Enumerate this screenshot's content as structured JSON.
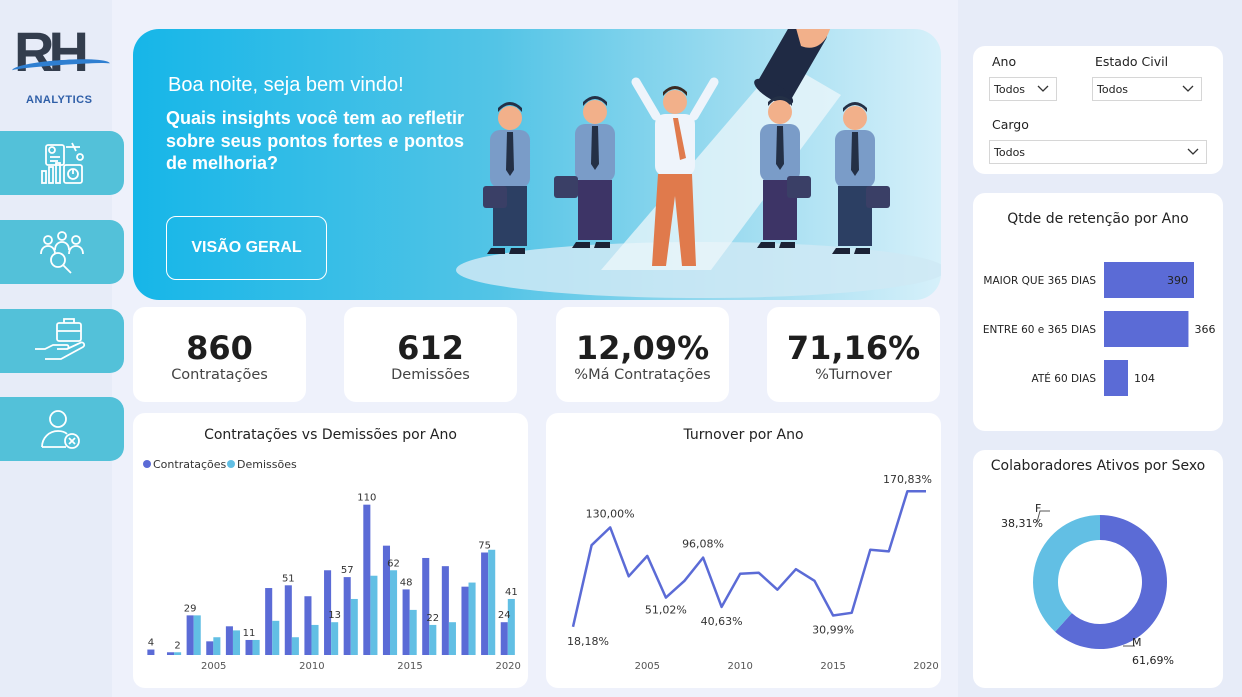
{
  "brand": {
    "logo_text": "RH",
    "logo_sub": "ANALYTICS"
  },
  "nav": [
    {
      "name": "dashboard-icon"
    },
    {
      "name": "people-search-icon"
    },
    {
      "name": "hand-briefcase-icon"
    },
    {
      "name": "user-remove-icon"
    }
  ],
  "hero": {
    "greeting": "Boa noite, seja bem vindo!",
    "question": "Quais insights você tem ao refletir sobre seus pontos fortes e pontos de melhoria?",
    "button": "VISÃO GERAL"
  },
  "kpis": [
    {
      "value": "860",
      "label": "Contratações"
    },
    {
      "value": "612",
      "label": "Demissões"
    },
    {
      "value": "12,09%",
      "label": "%Má Contratações"
    },
    {
      "value": "71,16%",
      "label": "%Turnover"
    }
  ],
  "filters": {
    "ano": {
      "label": "Ano",
      "value": "Todos"
    },
    "estado_civil": {
      "label": "Estado Civil",
      "value": "Todos"
    },
    "cargo": {
      "label": "Cargo",
      "value": "Todos"
    }
  },
  "colors": {
    "primary": "#5b6bd6",
    "secondary": "#62bfe4",
    "accent": "#53c1d9"
  },
  "chart_data": [
    {
      "type": "bar",
      "title": "Contratações vs Demissões por Ano",
      "legend": "top-left",
      "x": [
        2002,
        2003,
        2004,
        2005,
        2006,
        2007,
        2008,
        2009,
        2010,
        2011,
        2012,
        2013,
        2014,
        2015,
        2016,
        2017,
        2018,
        2019,
        2020
      ],
      "x_ticks": [
        "2005",
        "2010",
        "2015",
        "2020"
      ],
      "series": [
        {
          "name": "Contratações",
          "color": "#5b6bd6",
          "values": [
            4,
            2,
            29,
            10,
            21,
            11,
            49,
            51,
            43,
            62,
            57,
            110,
            80,
            48,
            71,
            65,
            50,
            75,
            24
          ]
        },
        {
          "name": "Demissões",
          "color": "#62bfe4",
          "values": [
            0,
            2,
            29,
            13,
            18,
            11,
            25,
            13,
            22,
            24,
            41,
            58,
            62,
            33,
            22,
            24,
            53,
            77,
            41
          ]
        }
      ],
      "data_labels": [
        {
          "x": 2002,
          "series": "Contratações",
          "text": "4"
        },
        {
          "x": 2003,
          "series": "Demissões",
          "text": "2"
        },
        {
          "x": 2004,
          "series": "Contratações",
          "text": "29"
        },
        {
          "x": 2007,
          "series": "Contratações",
          "text": "11"
        },
        {
          "x": 2009,
          "series": "Contratações",
          "text": "51"
        },
        {
          "x": 2011,
          "series": "Demissões",
          "text": "13"
        },
        {
          "x": 2012,
          "series": "Contratações",
          "text": "57"
        },
        {
          "x": 2013,
          "series": "Contratações",
          "text": "110"
        },
        {
          "x": 2014,
          "series": "Demissões",
          "text": "62"
        },
        {
          "x": 2015,
          "series": "Contratações",
          "text": "48"
        },
        {
          "x": 2016,
          "series": "Demissões",
          "text": "22"
        },
        {
          "x": 2019,
          "series": "Contratações",
          "text": "75"
        },
        {
          "x": 2020,
          "series": "Contratações",
          "text": "24"
        },
        {
          "x": 2020,
          "series": "Demissões",
          "text": "41"
        }
      ],
      "ylim": [
        0,
        120
      ]
    },
    {
      "type": "line",
      "title": "Turnover por Ano",
      "color": "#5b6bd6",
      "x": [
        2001,
        2002,
        2003,
        2004,
        2005,
        2006,
        2007,
        2008,
        2009,
        2010,
        2011,
        2012,
        2013,
        2014,
        2015,
        2016,
        2017,
        2018,
        2019,
        2020
      ],
      "x_ticks": [
        "2005",
        "2010",
        "2015",
        "2020"
      ],
      "values": [
        18.18,
        110,
        130,
        75,
        98,
        51.02,
        70,
        96.08,
        40.63,
        78,
        79,
        60,
        83,
        70,
        30.99,
        34,
        105,
        103,
        170.83,
        170.83
      ],
      "point_labels": [
        {
          "index": 0,
          "text": "18,18%"
        },
        {
          "index": 2,
          "text": "130,00%"
        },
        {
          "index": 5,
          "text": "51,02%"
        },
        {
          "index": 7,
          "text": "96,08%"
        },
        {
          "index": 8,
          "text": "40,63%"
        },
        {
          "index": 14,
          "text": "30,99%"
        },
        {
          "index": 19,
          "text": "170,83%"
        }
      ],
      "ylim": [
        0,
        180
      ]
    },
    {
      "type": "bar",
      "orientation": "horizontal",
      "title": "Qtde de retenção por Ano",
      "color": "#5b6bd6",
      "categories": [
        "MAIOR QUE 365 DIAS",
        "ENTRE 60 e 365 DIAS",
        "ATÉ 60 DIAS"
      ],
      "values": [
        390,
        366,
        104
      ],
      "value_labels": [
        "390",
        "366",
        "104"
      ]
    },
    {
      "type": "pie",
      "title": "Colaboradores Ativos por Sexo",
      "donut": true,
      "slices": [
        {
          "label": "M",
          "value": 61.69,
          "text": "61,69%",
          "color": "#5b6bd6"
        },
        {
          "label": "F",
          "value": 38.31,
          "text": "38,31%",
          "color": "#62bfe4"
        }
      ]
    }
  ]
}
